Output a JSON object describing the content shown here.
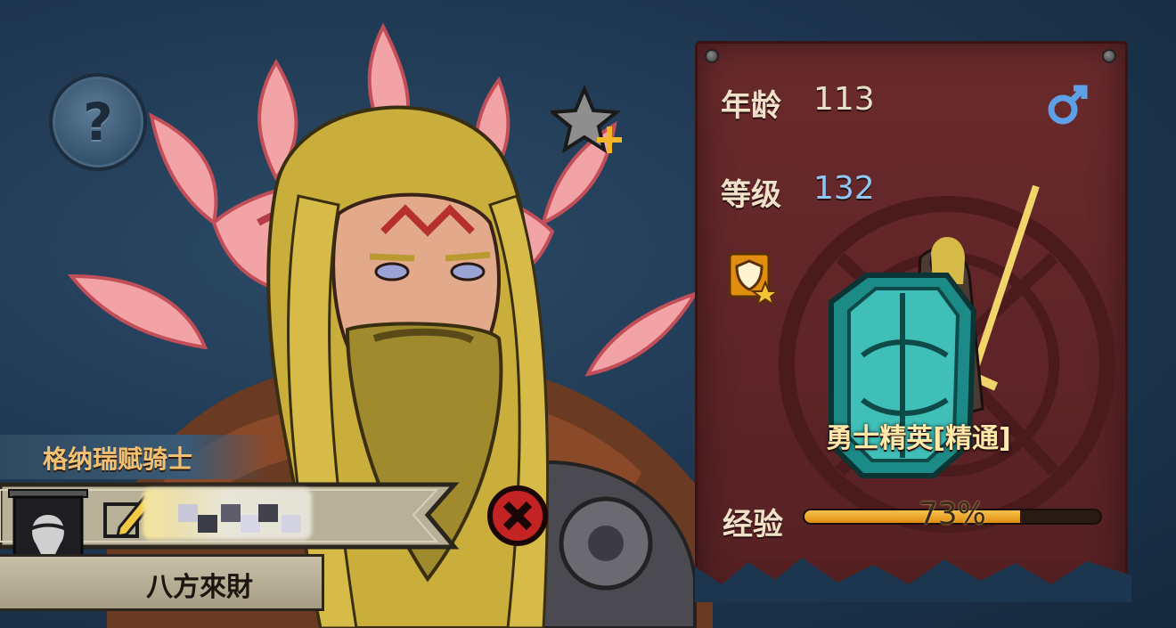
{
  "hero": {
    "title": "格纳瑞赋骑士",
    "nickname": "八方來財"
  },
  "stats": {
    "age_label": "年龄",
    "age_value": "113",
    "level_label": "等级",
    "level_value": "132",
    "exp_label": "经验",
    "exp_text": "73%",
    "exp_fraction": 0.73
  },
  "unit": {
    "class_name": "勇士精英[精通]"
  },
  "icons": {
    "help": "question-mark-icon",
    "star_plus": "star-plus-icon",
    "gender": "male-icon",
    "class_badge": "shield-star-icon",
    "edit": "pencil-edit-icon",
    "close": "close-x-icon",
    "banner": "guild-banner-icon"
  },
  "colors": {
    "panel": "#5e2427",
    "age_value": "#e8dfc8",
    "level_value": "#8fc7f5",
    "exp_fill": "#f0a830",
    "title_text": "#f2c070",
    "class_name": "#ffe8a8"
  }
}
